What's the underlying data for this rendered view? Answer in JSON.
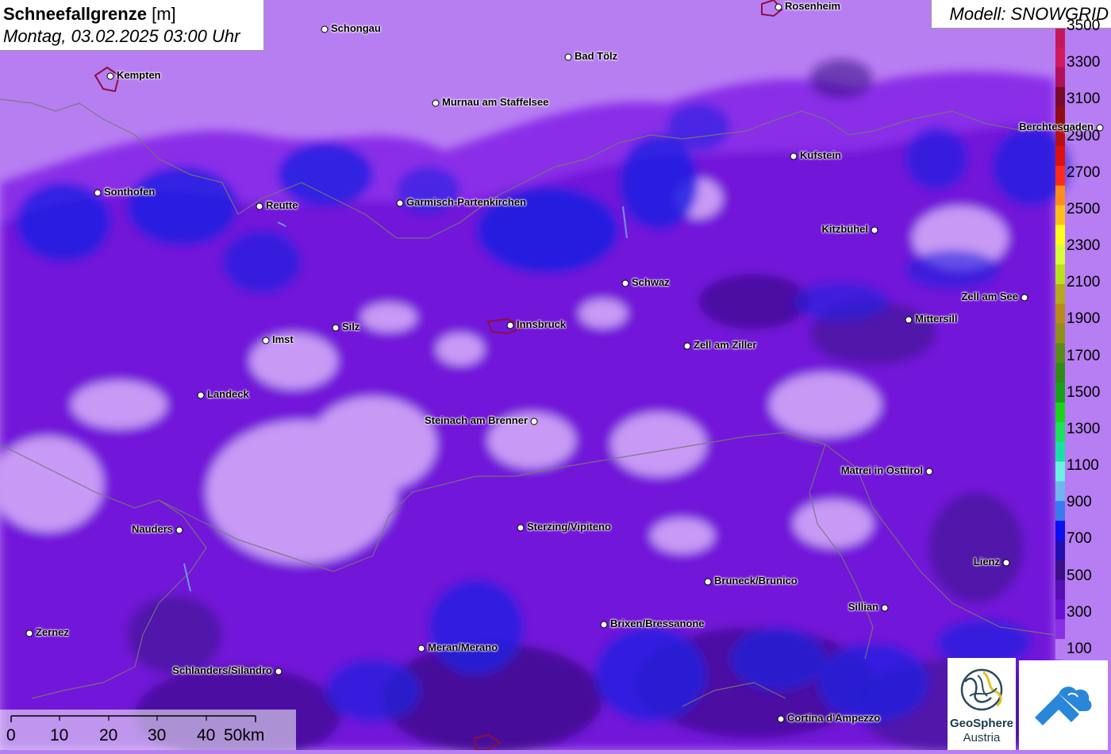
{
  "header": {
    "title_bold": "Schneefallgrenze",
    "title_unit": "[m]",
    "datetime": "Montag, 03.02.2025 03:00 Uhr",
    "model": "Modell: SNOWGRID"
  },
  "legend": {
    "unit": "m",
    "labels": [
      "3500",
      "3300",
      "3100",
      "2900",
      "2700",
      "2500",
      "2300",
      "2100",
      "1900",
      "1700",
      "1500",
      "1300",
      "1100",
      "900",
      "700",
      "500",
      "300",
      "100"
    ],
    "colors": [
      "#c2185b",
      "#d01a60",
      "#b0105a",
      "#7a0a2a",
      "#8f0d12",
      "#b80f14",
      "#dd1010",
      "#ff2a1a",
      "#ff8c1a",
      "#ffbf1a",
      "#ffff1a",
      "#d9ff3a",
      "#b8e01e",
      "#b8a81e",
      "#b88a1a",
      "#8f8f1a",
      "#5a8a1a",
      "#2f8a1a",
      "#1aa01a",
      "#1ad41a",
      "#1ae05a",
      "#1ae0a8",
      "#6cf0e0",
      "#6fb5ef",
      "#3a7af0",
      "#0b10f0",
      "#2010b0",
      "#3c0f8a",
      "#5410b4",
      "#6a10d4",
      "#8a2ee8",
      "#b77ef2"
    ]
  },
  "cities": [
    {
      "name": "Rosenheim",
      "label_side": "right"
    },
    {
      "name": "Schongau",
      "label_side": "right"
    },
    {
      "name": "Kempten",
      "label_side": "right"
    },
    {
      "name": "Bad Tölz",
      "label_side": "right"
    },
    {
      "name": "Murnau am Staffelsee",
      "label_side": "right"
    },
    {
      "name": "Berchtesgaden",
      "label_side": "left"
    },
    {
      "name": "Kufstein",
      "label_side": "right"
    },
    {
      "name": "Sonthofen",
      "label_side": "right"
    },
    {
      "name": "Reutte",
      "label_side": "right"
    },
    {
      "name": "Garmisch-Partenkirchen",
      "label_side": "right"
    },
    {
      "name": "Kitzbühel",
      "label_side": "left"
    },
    {
      "name": "Schwaz",
      "label_side": "right"
    },
    {
      "name": "Zell am See",
      "label_side": "left"
    },
    {
      "name": "Mittersill",
      "label_side": "right"
    },
    {
      "name": "Silz",
      "label_side": "right"
    },
    {
      "name": "Innsbruck",
      "label_side": "right"
    },
    {
      "name": "Imst",
      "label_side": "right"
    },
    {
      "name": "Zell am Ziller",
      "label_side": "right"
    },
    {
      "name": "Landeck",
      "label_side": "right"
    },
    {
      "name": "Steinach am Brenner",
      "label_side": "left"
    },
    {
      "name": "Matrei in Osttirol",
      "label_side": "left"
    },
    {
      "name": "Nauders",
      "label_side": "left"
    },
    {
      "name": "Sterzing/Vipiteno",
      "label_side": "right"
    },
    {
      "name": "Lienz",
      "label_side": "left"
    },
    {
      "name": "Bruneck/Brunico",
      "label_side": "right"
    },
    {
      "name": "Sillian",
      "label_side": "left"
    },
    {
      "name": "Brixen/Bressanone",
      "label_side": "right"
    },
    {
      "name": "Zernez",
      "label_side": "right"
    },
    {
      "name": "Meran/Merano",
      "label_side": "right"
    },
    {
      "name": "Schlanders/Silandro",
      "label_side": "left"
    },
    {
      "name": "Cortina d'Ampezzo",
      "label_side": "right"
    }
  ],
  "scale": {
    "labels": [
      "0",
      "10",
      "20",
      "30",
      "40",
      "50km"
    ]
  },
  "logos": {
    "geosphere_line1": "GeoSphere",
    "geosphere_line2": "Austria"
  }
}
